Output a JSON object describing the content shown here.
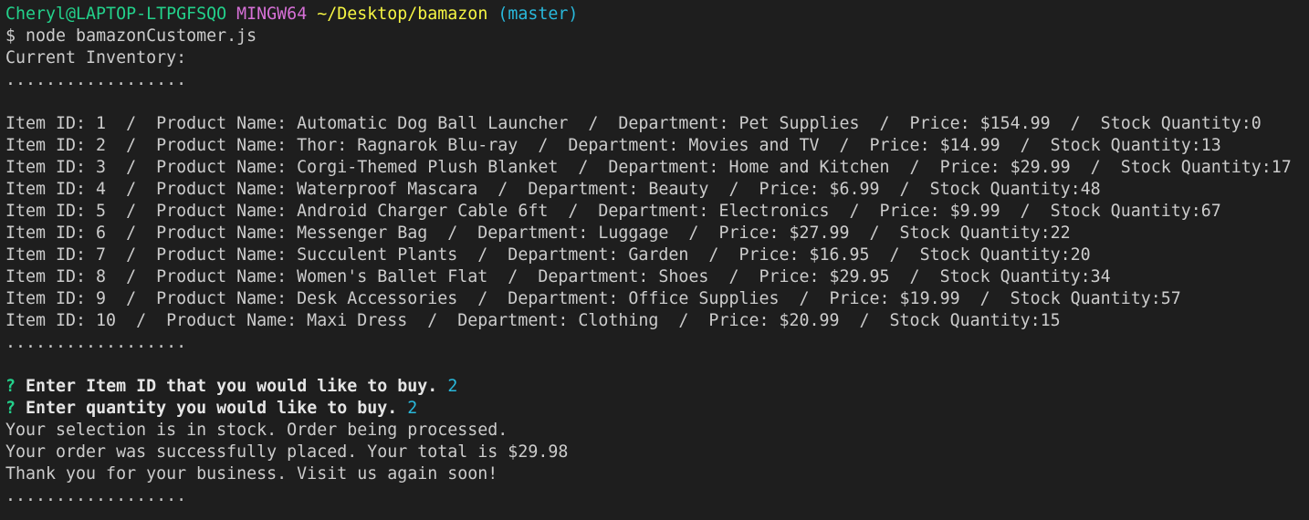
{
  "prompt": {
    "user_host": "Cheryl@LAPTOP-LTPGFSQO",
    "shell": "MINGW64",
    "path": "~/Desktop/bamazon",
    "branch": "(master)",
    "symbol": "$",
    "command": "node bamazonCustomer.js"
  },
  "output": {
    "heading": "Current Inventory:",
    "divider": "..................",
    "items": [
      "Item ID: 1  /  Product Name: Automatic Dog Ball Launcher  /  Department: Pet Supplies  /  Price: $154.99  /  Stock Quantity:0",
      "Item ID: 2  /  Product Name: Thor: Ragnarok Blu-ray  /  Department: Movies and TV  /  Price: $14.99  /  Stock Quantity:13",
      "Item ID: 3  /  Product Name: Corgi-Themed Plush Blanket  /  Department: Home and Kitchen  /  Price: $29.99  /  Stock Quantity:17",
      "Item ID: 4  /  Product Name: Waterproof Mascara  /  Department: Beauty  /  Price: $6.99  /  Stock Quantity:48",
      "Item ID: 5  /  Product Name: Android Charger Cable 6ft  /  Department: Electronics  /  Price: $9.99  /  Stock Quantity:67",
      "Item ID: 6  /  Product Name: Messenger Bag  /  Department: Luggage  /  Price: $27.99  /  Stock Quantity:22",
      "Item ID: 7  /  Product Name: Succulent Plants  /  Department: Garden  /  Price: $16.95  /  Stock Quantity:20",
      "Item ID: 8  /  Product Name: Women's Ballet Flat  /  Department: Shoes  /  Price: $29.95  /  Stock Quantity:34",
      "Item ID: 9  /  Product Name: Desk Accessories  /  Department: Office Supplies  /  Price: $19.99  /  Stock Quantity:57",
      "Item ID: 10  /  Product Name: Maxi Dress  /  Department: Clothing  /  Price: $20.99  /  Stock Quantity:15"
    ],
    "question_mark": "?",
    "q1_text": "Enter Item ID that you would like to buy.",
    "q1_answer": "2",
    "q2_text": "Enter quantity you would like to buy.",
    "q2_answer": "2",
    "msg_stock": "Your selection is in stock. Order being processed.",
    "msg_order": "Your order was successfully placed. Your total is $29.98",
    "msg_thanks": "Thank you for your business. Visit us again soon!"
  },
  "colors": {
    "background": "#1e1e1e",
    "text": "#cccccc",
    "user_host": "#23d18b",
    "shell": "#d670d6",
    "path": "#f5f543",
    "branch": "#29b8db",
    "answer": "#29b8db"
  }
}
